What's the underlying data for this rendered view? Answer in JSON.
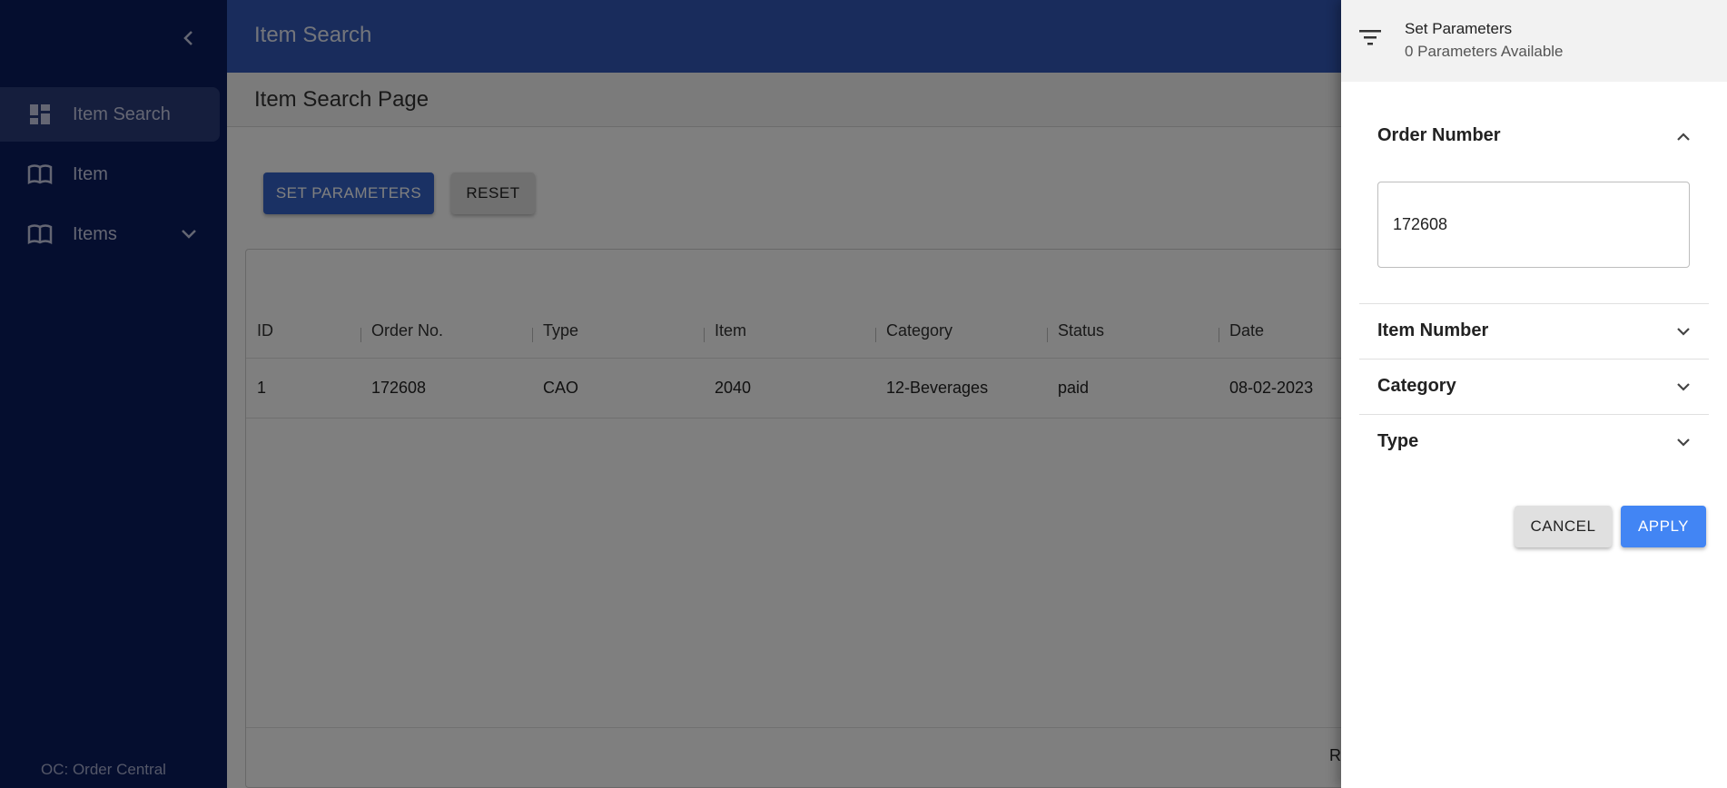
{
  "sidebar": {
    "items": [
      {
        "label": "Item Search",
        "icon": "dashboard-icon",
        "active": true
      },
      {
        "label": "Item",
        "icon": "book-icon"
      },
      {
        "label": "Items",
        "icon": "book-icon",
        "expandable": true
      }
    ],
    "footer": "OC: Order Central"
  },
  "header": {
    "title": "Item Search"
  },
  "page": {
    "title": "Item Search Page"
  },
  "toolbar": {
    "set_parameters_label": "SET PARAMETERS",
    "reset_label": "RESET"
  },
  "table": {
    "columns": [
      "ID",
      "Order No.",
      "Type",
      "Item",
      "Category",
      "Status",
      "Date"
    ],
    "rows": [
      [
        "1",
        "172608",
        "CAO",
        "2040",
        "12-Beverages",
        "paid",
        "08-02-2023"
      ]
    ],
    "footer_text": "R"
  },
  "drawer": {
    "title": "Set Parameters",
    "subtitle": "0 Parameters Available",
    "sections": [
      {
        "label": "Order Number",
        "expanded": true,
        "value": "172608"
      },
      {
        "label": "Item Number",
        "expanded": false
      },
      {
        "label": "Category",
        "expanded": false
      },
      {
        "label": "Type",
        "expanded": false
      }
    ],
    "cancel_label": "CANCEL",
    "apply_label": "APPLY"
  },
  "colors": {
    "sidebar": "#0b1c5e",
    "topbar": "#3259b8",
    "primary": "#3563c9",
    "apply": "#4285f4"
  }
}
